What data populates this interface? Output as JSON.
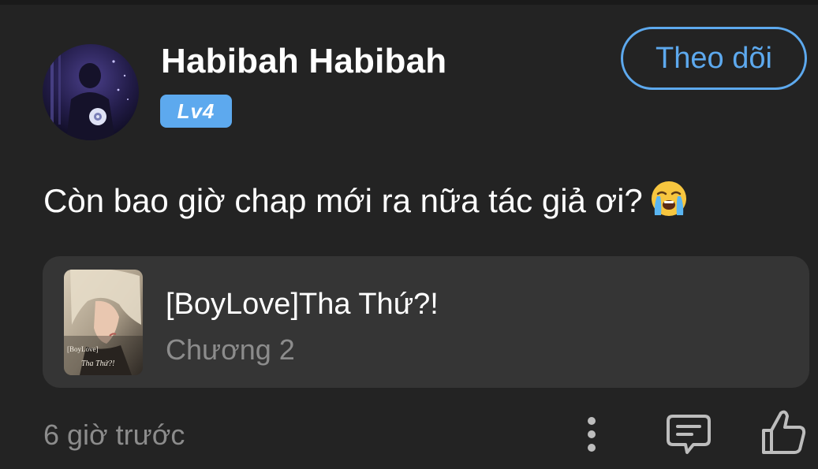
{
  "comment": {
    "author": {
      "name": "Habibah Habibah",
      "level": "Lv4",
      "avatar_icon": "user-avatar-dark-hooded-figure"
    },
    "follow_label": "Theo dõi",
    "text": "Còn bao giờ chap mới ra nữa tác giả ơi?",
    "emoji": "loudly-crying-face",
    "story": {
      "title": "[BoyLove]Tha Thứ?!",
      "chapter": "Chương 2",
      "cover_caption_line1": "[BoyLove]",
      "cover_caption_line2": "Tha Thứ?!"
    },
    "timestamp": "6 giờ trước",
    "actions": {
      "more_icon": "more-vertical-icon",
      "reply_icon": "comment-reply-icon",
      "like_icon": "thumbs-up-icon"
    }
  },
  "colors": {
    "background": "#232323",
    "card": "#353535",
    "accent": "#5da9ee",
    "muted_text": "#8c8c8c",
    "icon": "#bdbdbd"
  }
}
